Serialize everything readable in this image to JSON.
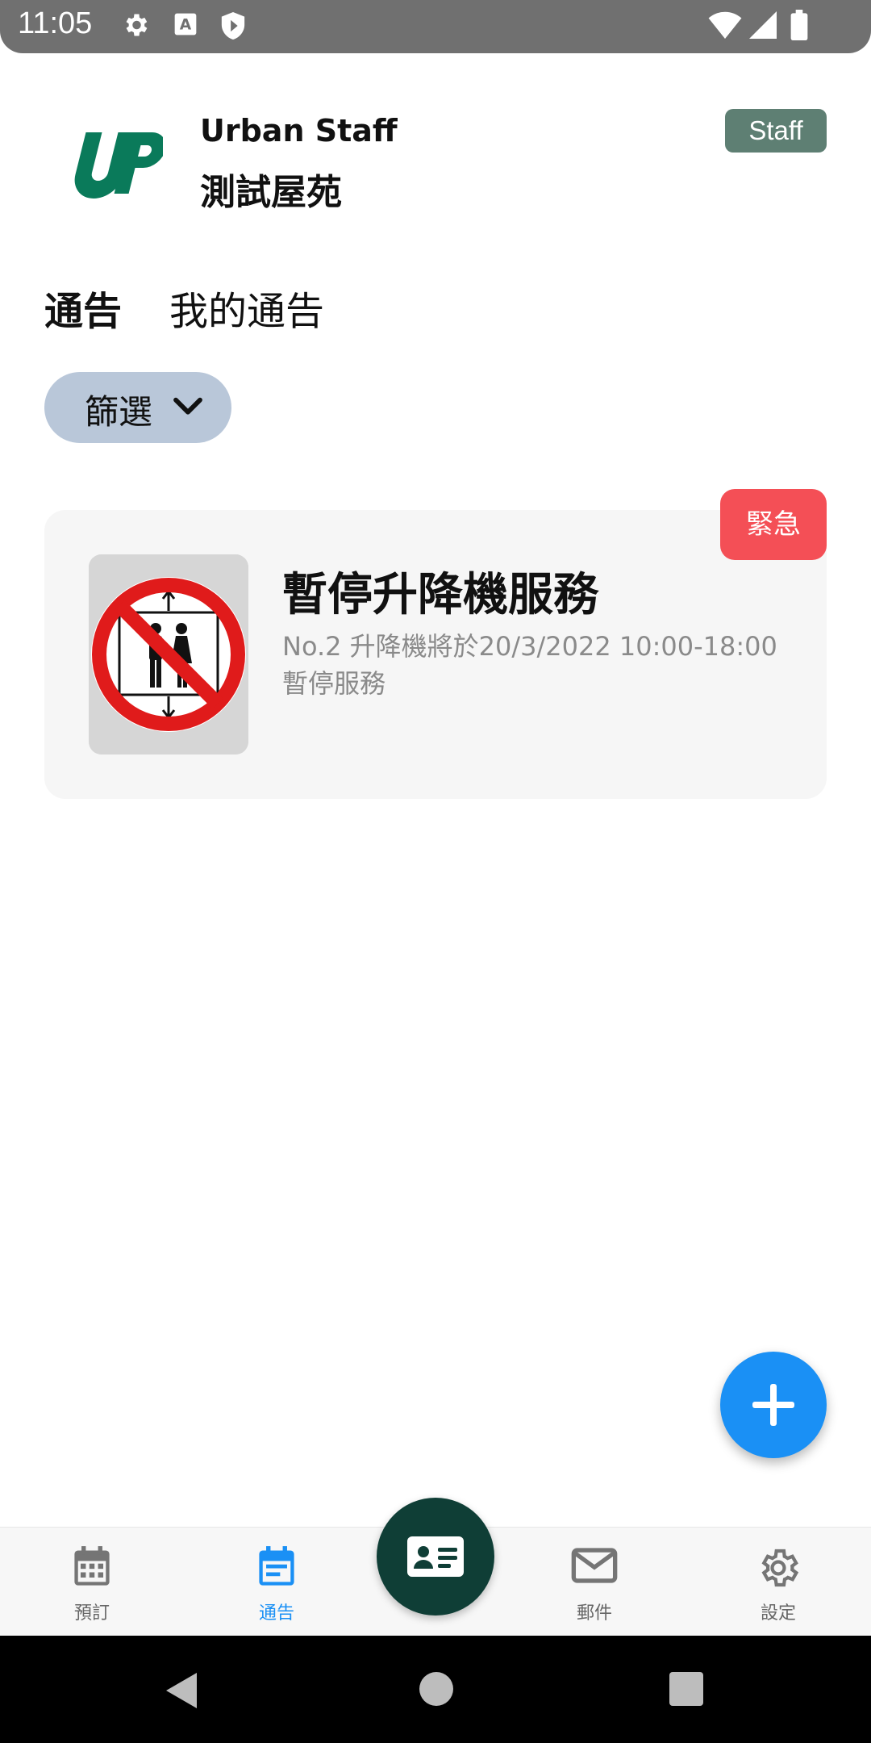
{
  "status_bar": {
    "time": "11:05",
    "left_icons": [
      "gear-icon",
      "a-icon",
      "shield-icon"
    ],
    "right_icons": [
      "wifi-icon",
      "signal-icon",
      "battery-icon"
    ]
  },
  "header": {
    "logo_text": "UP",
    "app_name": "Urban Staff",
    "estate_name": "測試屋苑",
    "role_badge": "Staff"
  },
  "tabs": [
    {
      "label": "通告",
      "active": true
    },
    {
      "label": "我的通告",
      "active": false
    }
  ],
  "filter": {
    "label": "篩選",
    "icon": "chevron-down-icon"
  },
  "notices": [
    {
      "title": "暫停升降機服務",
      "description": "No.2 升降機將於20/3/2022 10:00-18:00 暫停服務",
      "badge": "緊急",
      "image": "no-lift-sign"
    }
  ],
  "fab": {
    "icon": "plus-icon"
  },
  "bottom_nav": {
    "items": [
      {
        "label": "預訂",
        "icon": "calendar-icon",
        "active": false
      },
      {
        "label": "通告",
        "icon": "notice-calendar-icon",
        "active": true
      },
      {
        "label": "郵件",
        "icon": "mail-icon",
        "active": false
      },
      {
        "label": "設定",
        "icon": "settings-icon",
        "active": false
      }
    ],
    "center_button_icon": "id-card-icon"
  },
  "colors": {
    "accent": "#1a90f5",
    "urgent": "#f44f56",
    "badge": "#5e7f73",
    "logo": "#0a7a5a",
    "filter_bg": "#b9c7d9",
    "center_button": "#0f3e36"
  }
}
